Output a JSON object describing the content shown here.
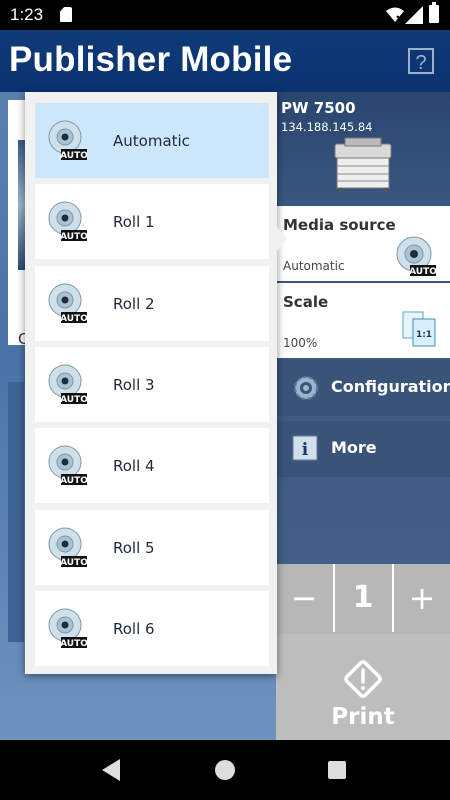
{
  "status": {
    "time": "1:23"
  },
  "header": {
    "title": "Publisher Mobile",
    "help_label": "?"
  },
  "background_doc": {
    "caption": "C"
  },
  "printer": {
    "name": "PW 7500",
    "ip": "134.188.145.84"
  },
  "media_source": {
    "label": "Media source",
    "value": "Automatic",
    "icon_badge": "AUTO"
  },
  "scale": {
    "label": "Scale",
    "value": "100%",
    "icon_text": "1:1"
  },
  "menu": {
    "configuration": "Configuration",
    "more": "More"
  },
  "copies": {
    "minus": "−",
    "value": "1",
    "plus": "+"
  },
  "print": {
    "label": "Print"
  },
  "dropdown": {
    "options": [
      {
        "label": "Automatic",
        "badge": "AUTO",
        "selected": true
      },
      {
        "label": "Roll 1",
        "badge": "AUTO",
        "selected": false
      },
      {
        "label": "Roll 2",
        "badge": "AUTO",
        "selected": false
      },
      {
        "label": "Roll 3",
        "badge": "AUTO",
        "selected": false
      },
      {
        "label": "Roll 4",
        "badge": "AUTO",
        "selected": false
      },
      {
        "label": "Roll 5",
        "badge": "AUTO",
        "selected": false
      },
      {
        "label": "Roll 6",
        "badge": "AUTO",
        "selected": false
      }
    ]
  },
  "colors": {
    "header": "#0f3a78",
    "selected_option": "#cce6fb",
    "panel": "#3a5479"
  }
}
